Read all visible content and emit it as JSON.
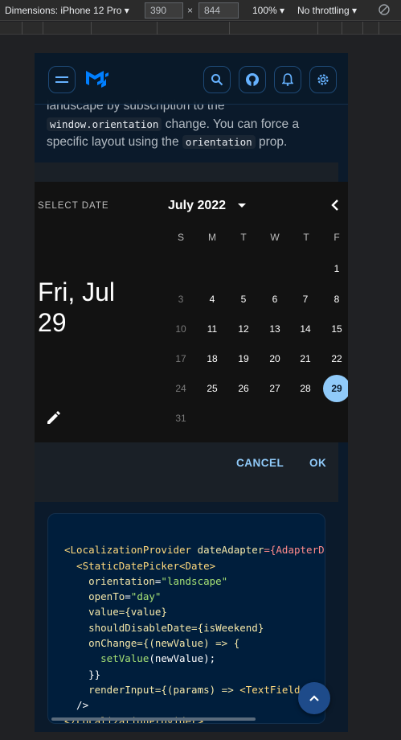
{
  "devtools": {
    "dimensions_label": "Dimensions: iPhone 12 Pro ▾",
    "width_value": "390",
    "height_value": "844",
    "times": "×",
    "zoom": "100% ▾",
    "throttle": "No throttling ▾"
  },
  "docs": {
    "line1": "landscape by subscription to the",
    "code1": "window.orientation",
    "line2_after": " change. You can force a",
    "line3_before": "specific layout using the ",
    "code2": "orientation",
    "line3_after": " prop."
  },
  "picker": {
    "select_label": "SELECT DATE",
    "big_date_line1": "Fri, Jul",
    "big_date_line2": "29",
    "month_label": "July 2022",
    "weekdays": [
      "S",
      "M",
      "T",
      "W",
      "T",
      "F"
    ],
    "days": {
      "d1": "1",
      "d3": "3",
      "d4": "4",
      "d5": "5",
      "d6": "6",
      "d7": "7",
      "d8": "8",
      "d10": "10",
      "d11": "11",
      "d12": "12",
      "d13": "13",
      "d14": "14",
      "d15": "15",
      "d17": "17",
      "d18": "18",
      "d19": "19",
      "d20": "20",
      "d21": "21",
      "d22": "22",
      "d24": "24",
      "d25": "25",
      "d26": "26",
      "d27": "27",
      "d28": "28",
      "d29": "29",
      "d31": "31"
    },
    "selected_day": "29",
    "cancel_label": "CANCEL",
    "ok_label": "OK"
  },
  "code": {
    "l1_tag": "<LocalizationProvider",
    "l1_attr": " dateAdapter",
    "l1_rest": "={AdapterD",
    "l2": "  <StaticDatePicker<Date>",
    "l3_attr": "    orientation",
    "l3_str": "\"landscape\"",
    "l4_attr": "    openTo",
    "l4_str": "\"day\"",
    "l5": "    value={value}",
    "l6": "    shouldDisableDate={isWeekend}",
    "l7": "    onChange={(newValue) => {",
    "l8_fn": "      setValue",
    "l8_rest": "(newValue);",
    "l9": "    }}",
    "l10_a": "    renderInput={(params) => ",
    "l10_tag": "<TextField",
    "l10_b": " {..",
    "l11": "  />",
    "l12_tag": "</LocalizationProvider>"
  },
  "colors": {
    "accent": "#90caf9",
    "background": "#0a1929",
    "picker_bg": "#121212"
  }
}
